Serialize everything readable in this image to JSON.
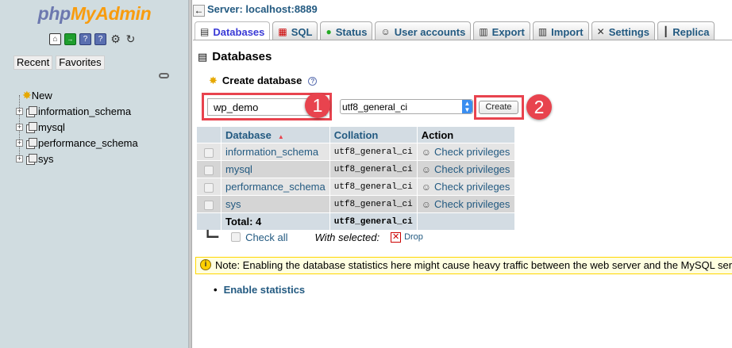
{
  "nav": {
    "logo_part1": "php",
    "logo_part2": "MyAdmin",
    "tab_recent": "Recent",
    "tab_favorites": "Favorites",
    "icons": [
      "home-icon",
      "exit-icon",
      "docs-icon",
      "sql-docs-icon",
      "settings-icon",
      "reload-icon"
    ],
    "tree": [
      {
        "label": "New"
      },
      {
        "label": "information_schema"
      },
      {
        "label": "mysql"
      },
      {
        "label": "performance_schema"
      },
      {
        "label": "sys"
      }
    ]
  },
  "breadcrumb": {
    "server": "Server: localhost:8889"
  },
  "tabs": [
    {
      "label": "Databases",
      "icon": "databases-icon",
      "active": true
    },
    {
      "label": "SQL",
      "icon": "sql-icon"
    },
    {
      "label": "Status",
      "icon": "status-icon"
    },
    {
      "label": "User accounts",
      "icon": "user-accounts-icon"
    },
    {
      "label": "Export",
      "icon": "export-icon"
    },
    {
      "label": "Import",
      "icon": "import-icon"
    },
    {
      "label": "Settings",
      "icon": "settings-icon"
    },
    {
      "label": "Replica",
      "icon": "replication-icon"
    }
  ],
  "page": {
    "title": "Databases",
    "create_label": "Create database",
    "db_name_value": "wp_demo",
    "collation_value": "utf8_general_ci",
    "create_button": "Create"
  },
  "annotations": [
    "1",
    "2"
  ],
  "table": {
    "headers": [
      "Database",
      "Collation",
      "Action"
    ],
    "rows": [
      {
        "name": "information_schema",
        "collation": "utf8_general_ci",
        "action": "Check privileges"
      },
      {
        "name": "mysql",
        "collation": "utf8_general_ci",
        "action": "Check privileges"
      },
      {
        "name": "performance_schema",
        "collation": "utf8_general_ci",
        "action": "Check privileges"
      },
      {
        "name": "sys",
        "collation": "utf8_general_ci",
        "action": "Check privileges"
      }
    ],
    "total_label": "Total: 4",
    "total_collation": "utf8_general_ci"
  },
  "footer": {
    "check_all": "Check all",
    "with_selected": "With selected:",
    "drop": "Drop"
  },
  "notice": "Note: Enabling the database statistics here might cause heavy traffic between the web server and the MySQL server.",
  "enable_stats": "Enable statistics",
  "colors": {
    "annotation": "#e8434e",
    "link": "#235a81",
    "nav_bg": "#d0dce0"
  }
}
